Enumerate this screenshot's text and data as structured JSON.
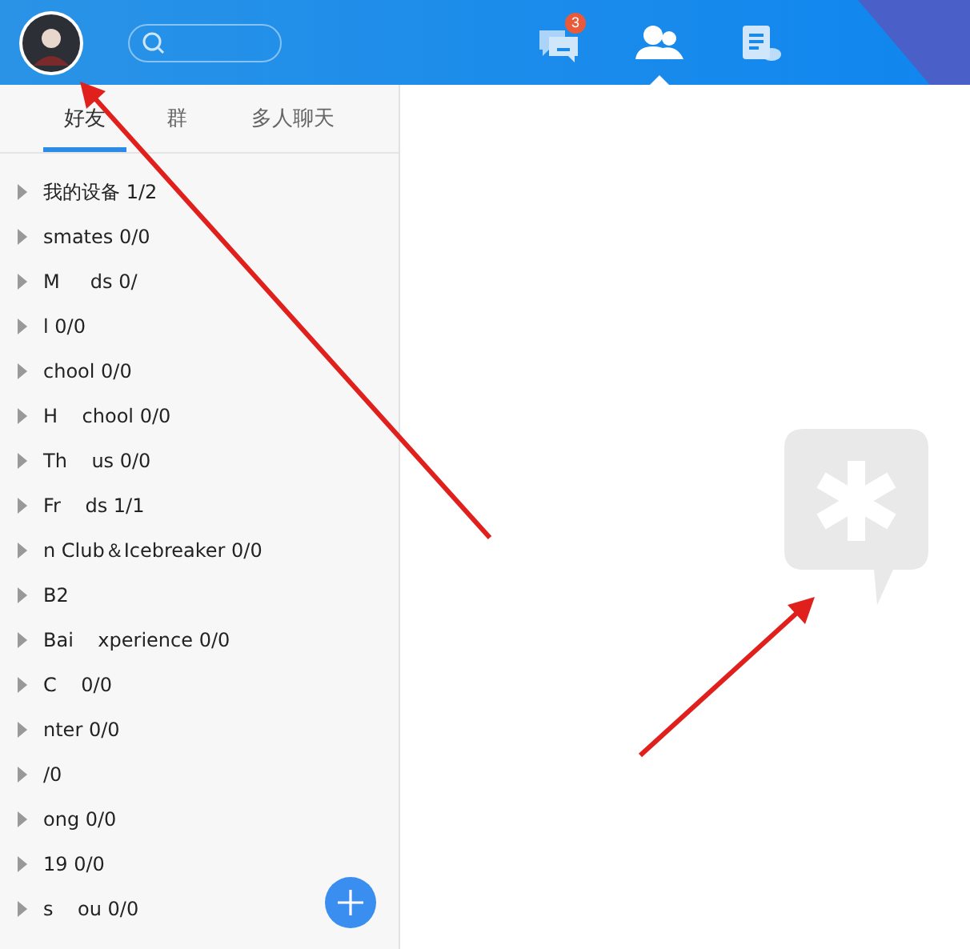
{
  "header": {
    "nav_icons": [
      {
        "kind": "chat",
        "selected": false,
        "badge": "3"
      },
      {
        "kind": "contacts",
        "selected": true
      },
      {
        "kind": "notes",
        "selected": false
      }
    ]
  },
  "tabs": [
    {
      "label": "好友",
      "selected": true
    },
    {
      "label": "群",
      "selected": false
    },
    {
      "label": "多人聊天",
      "selected": false
    }
  ],
  "groups": [
    {
      "label": "我的设备 1/2",
      "expanded": false
    },
    {
      "label": "smates 0/0",
      "expanded": false
    },
    {
      "label": "M     ds 0/",
      "expanded": false
    },
    {
      "label": "l 0/0",
      "expanded": false
    },
    {
      "label": "chool 0/0",
      "expanded": false
    },
    {
      "label": "H    chool 0/0",
      "expanded": false
    },
    {
      "label": "Th    us 0/0",
      "expanded": false
    },
    {
      "label": "Fr    ds 1/1",
      "expanded": false
    },
    {
      "label": "n Club＆Icebreaker 0/0",
      "expanded": false
    },
    {
      "label": "B2",
      "expanded": false
    },
    {
      "label": "Bai    xperience 0/0",
      "expanded": false
    },
    {
      "label": "C    0/0",
      "expanded": false
    },
    {
      "label": "nter 0/0",
      "expanded": false
    },
    {
      "label": "/0",
      "expanded": false
    },
    {
      "label": "ong 0/0",
      "expanded": false
    },
    {
      "label": "19 0/0",
      "expanded": false
    },
    {
      "label": "s    ou 0/0",
      "expanded": false
    }
  ]
}
